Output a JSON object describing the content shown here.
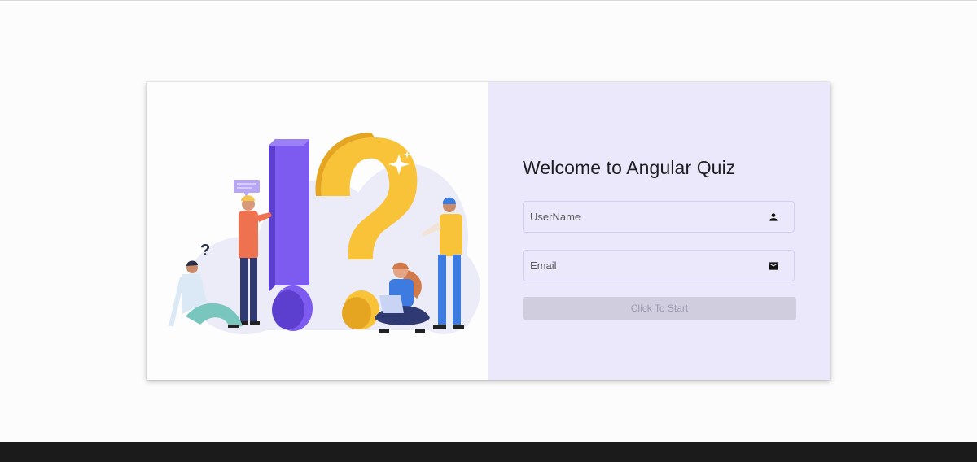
{
  "welcome": {
    "title": "Welcome to Angular Quiz"
  },
  "form": {
    "username": {
      "placeholder": "UserName",
      "value": "",
      "icon": "person-icon"
    },
    "email": {
      "placeholder": "Email",
      "value": "",
      "icon": "mail-icon"
    },
    "start_button": {
      "label": "Click To Start",
      "enabled": false
    }
  },
  "colors": {
    "panel_bg": "#ebe8fc",
    "accent_purple": "#7d5bf0",
    "accent_yellow": "#f8c338",
    "button_disabled_bg": "#cfcdde",
    "button_disabled_text": "#9e9bb0"
  }
}
